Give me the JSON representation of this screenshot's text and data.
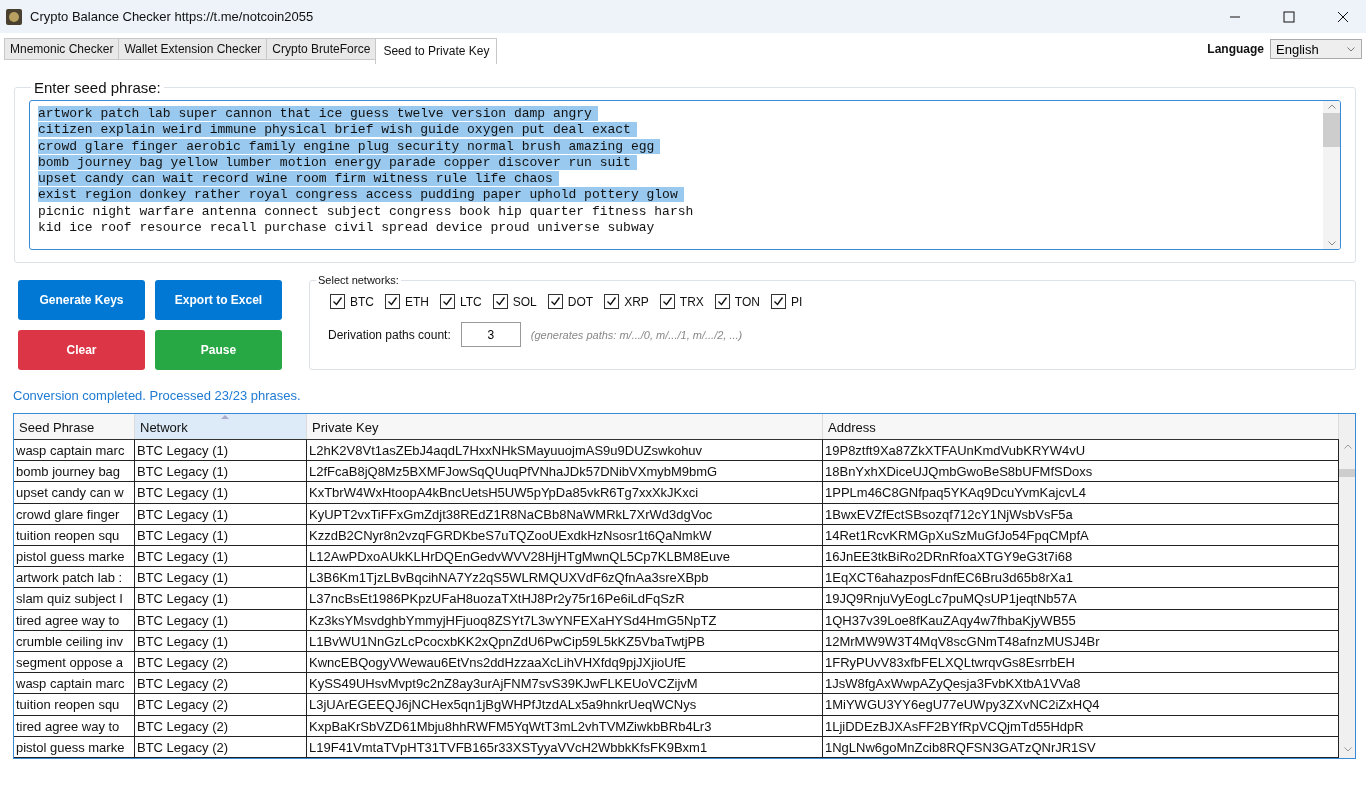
{
  "window": {
    "title": "Crypto Balance Checker https://t.me/notcoin2055"
  },
  "tabs": [
    {
      "label": "Mnemonic Checker",
      "selected": false
    },
    {
      "label": "Wallet Extension Checker",
      "selected": false
    },
    {
      "label": "Crypto BruteForce",
      "selected": false
    },
    {
      "label": "Seed to Private Key",
      "selected": true
    }
  ],
  "language": {
    "label": "Language",
    "value": "English"
  },
  "seed_input": {
    "legend": "Enter seed phrase:",
    "lines": [
      {
        "text": "artwork patch lab super cannon that ice guess twelve version damp angry",
        "selected": true
      },
      {
        "text": "citizen explain weird immune physical brief wish guide oxygen put deal exact",
        "selected": true
      },
      {
        "text": "crowd glare finger aerobic family engine plug security normal brush amazing egg",
        "selected": true
      },
      {
        "text": "bomb journey bag yellow lumber motion energy parade copper discover run suit",
        "selected": true
      },
      {
        "text": "upset candy can wait record wine room firm witness rule life chaos",
        "selected": true
      },
      {
        "text": "exist region donkey rather royal congress access pudding paper uphold pottery glow",
        "selected": true
      },
      {
        "text": "picnic night warfare antenna connect subject congress book hip quarter fitness harsh",
        "selected": false
      },
      {
        "text": "kid ice roof resource recall purchase civil spread device proud universe subway",
        "selected": false
      }
    ]
  },
  "buttons": [
    {
      "label": "Generate Keys",
      "kind": "blue"
    },
    {
      "label": "Export to Excel",
      "kind": "blue"
    },
    {
      "label": "Clear",
      "kind": "red"
    },
    {
      "label": "Pause",
      "kind": "green"
    }
  ],
  "networks": {
    "legend": "Select networks:",
    "items": [
      {
        "label": "BTC",
        "checked": true
      },
      {
        "label": "ETH",
        "checked": true
      },
      {
        "label": "LTC",
        "checked": true
      },
      {
        "label": "SOL",
        "checked": true
      },
      {
        "label": "DOT",
        "checked": true
      },
      {
        "label": "XRP",
        "checked": true
      },
      {
        "label": "TRX",
        "checked": true
      },
      {
        "label": "TON",
        "checked": true
      },
      {
        "label": "PI",
        "checked": true
      }
    ],
    "derivation_label": "Derivation paths count:",
    "derivation_value": "3",
    "derivation_hint": "(generates paths: m/.../0, m/.../1, m/.../2, ...)"
  },
  "status": "Conversion completed. Processed 23/23 phrases.",
  "table": {
    "columns": [
      {
        "label": "Seed Phrase",
        "sorted": false
      },
      {
        "label": "Network",
        "sorted": true
      },
      {
        "label": "Private Key",
        "sorted": false
      },
      {
        "label": "Address",
        "sorted": false
      }
    ],
    "rows": [
      [
        "wasp captain marc",
        "BTC Legacy (1)",
        "L2hK2V8Vt1asZEbJ4aqdL7HxxNHkSMayuuojmAS9u9DUZswkohuv",
        "19P8ztft9Xa87ZkXTFAUnKmdVubKRYW4vU"
      ],
      [
        "bomb journey bag",
        "BTC Legacy (1)",
        "L2fFcaB8jQ8Mz5BXMFJowSqQUuqPfVNhaJDk57DNibVXmybM9bmG",
        "18BnYxhXDiceUJQmbGwoBeS8bUFMfSDoxs"
      ],
      [
        "upset candy can w",
        "BTC Legacy (1)",
        "KxTbrW4WxHtoopA4kBncUetsH5UW5pYpDa85vkR6Tg7xxXkJKxci",
        "1PPLm46C8GNfpaq5YKAq9DcuYvmKajcvL4"
      ],
      [
        "crowd glare finger",
        "BTC Legacy (1)",
        "KyUPT2vxTiFFxGmZdjt38REdZ1R8NaCBb8NaWMRkL7XrWd3dgVoc",
        "1BwxEVZfEctSBsozqf712cY1NjWsbVsF5a"
      ],
      [
        "tuition reopen squ",
        "BTC Legacy (1)",
        "KzzdB2CNyr8n2vzqFGRDKbeS7uTQZooUExdkHzNsosr1t6QaNmkW",
        "14Ret1RcvKRMGpXuSzMuGfJo54FpqCMpfA"
      ],
      [
        "pistol guess marke",
        "BTC Legacy (1)",
        "L12AwPDxoAUkKLHrDQEnGedvWVV28HjHTgMwnQL5Cp7KLBM8Euve",
        "16JnEE3tkBiRo2DRnRfoaXTGY9eG3t7i68"
      ],
      [
        "artwork patch lab :",
        "BTC Legacy (1)",
        "L3B6Km1TjzLBvBqcihNA7Yz2qS5WLRMQUXVdF6zQfnAa3sreXBpb",
        "1EqXCT6ahazposFdnfEC6Bru3d65b8rXa1"
      ],
      [
        "slam quiz subject I",
        "BTC Legacy (1)",
        "L37ncBsEt1986PKpzUFaH8uozaTXtHJ8Pr2y75r16Pe6iLdFqSzR",
        "19JQ9RnjuVyEogLc7puMQsUP1jeqtNb57A"
      ],
      [
        "tired agree way to",
        "BTC Legacy (1)",
        "Kz3ksYMsvdghbYmmyjHFjuoq8ZSYt7L3wYNFEXaHYSd4HmG5NpTZ",
        "1QH37v39Loe8fKauZAqy4w7fhbaKjyWB55"
      ],
      [
        "crumble ceiling inv",
        "BTC Legacy (1)",
        "L1BvWU1NnGzLcPcocxbKK2xQpnZdU6PwCip59L5kKZ5VbaTwtjPB",
        "12MrMW9W3T4MqV8scGNmT48afnzMUSJ4Br"
      ],
      [
        "segment oppose a",
        "BTC Legacy (2)",
        "KwncEBQogyVWewau6EtVns2ddHzzaaXcLihVHXfdq9pjJXjioUfE",
        "1FRyPUvV83xfbFELXQLtwrqvGs8EsrrbEH"
      ],
      [
        "wasp captain marc",
        "BTC Legacy (2)",
        "KySS49UHsvMvpt9c2nZ8ay3urAjFNM7svS39KJwFLKEUoVCZijvM",
        "1JsW8fgAxWwpAZyQesja3FvbKXtbA1VVa8"
      ],
      [
        "tuition reopen squ",
        "BTC Legacy (2)",
        "L3jUArEGEEQJ6jNCHex5qn1jBgWHPfJtzdALx5a9hnkrUeqWCNys",
        "1MiYWGU3YY6egU77eUWpy3ZXvNC2iZxHQ4"
      ],
      [
        "tired agree way to",
        "BTC Legacy (2)",
        "KxpBaKrSbVZD61Mbju8hhRWFM5YqWtT3mL2vhTVMZiwkbBRb4Lr3",
        "1LjiDDEzBJXAsFF2BYfRpVCQjmTd55HdpR"
      ],
      [
        "pistol guess marke",
        "BTC Legacy (2)",
        "L19F41VmtaTVpHT31TVFB165r33XSTyyaVVcH2WbbkKfsFK9Bxm1",
        "1NgLNw6goMnZcib8RQFSN3GATzQNrJR1SV"
      ]
    ]
  }
}
